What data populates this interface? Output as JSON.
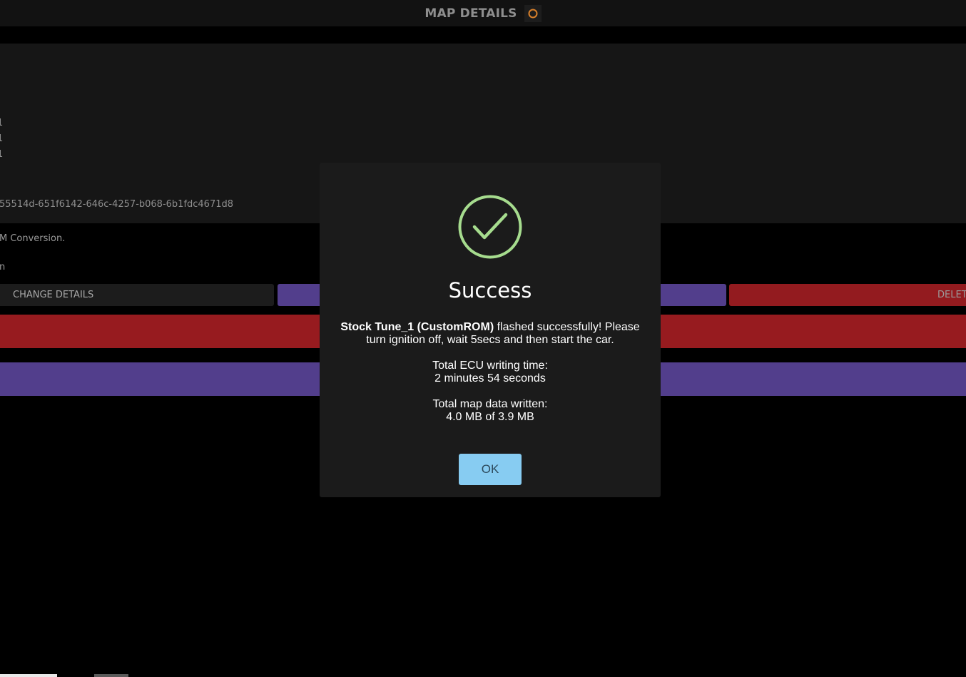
{
  "header": {
    "title": "MAP DETAILS",
    "icon": "ring-icon",
    "icon_color": "#d8802a"
  },
  "panel": {
    "lines": [
      "1",
      "1",
      "1"
    ],
    "id_fragment": "55514d-651f6142-646c-4257-b068-6b1fdc4671d8"
  },
  "background": {
    "conversion_text": "M Conversion.",
    "fragment_text": "n"
  },
  "buttons": {
    "change_details": "CHANGE DETAILS",
    "delete": "DELETE"
  },
  "modal": {
    "icon": "check-circle-icon",
    "icon_color": "#a6dc8e",
    "title": "Success",
    "message_bold": "Stock Tune_1 (CustomROM)",
    "message_rest": " flashed successfully! Please turn ignition off, wait 5secs and then start the car.",
    "writing_time_label": "Total ECU writing time:",
    "writing_time_value": "2 minutes 54 seconds",
    "data_written_label": "Total map data written:",
    "data_written_value": "4.0 MB of 3.9 MB",
    "ok_label": "OK"
  },
  "colors": {
    "accent_purple": "#523e8c",
    "danger_red": "#971b1f",
    "ok_blue": "#87ccf2"
  }
}
